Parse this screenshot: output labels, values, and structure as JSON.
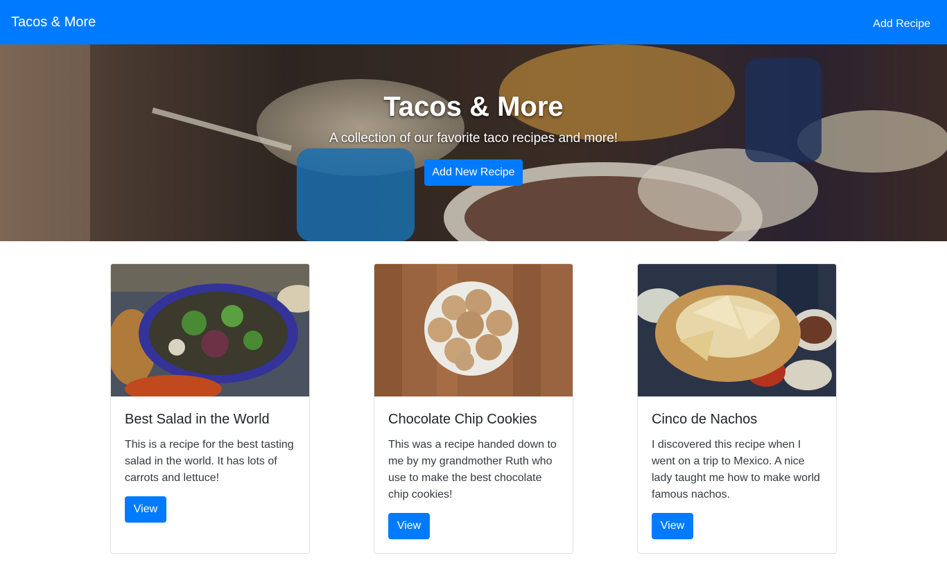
{
  "navbar": {
    "brand": "Tacos & More",
    "add_recipe_link": "Add Recipe"
  },
  "hero": {
    "title": "Tacos & More",
    "subtitle": "A collection of our favorite taco recipes and more!",
    "button_label": "Add New Recipe"
  },
  "cards": [
    {
      "title": "Best Salad in the World",
      "text": "This is a recipe for the best tasting salad in the world. It has lots of carrots and lettuce!",
      "button_label": "View"
    },
    {
      "title": "Chocolate Chip Cookies",
      "text": "This was a recipe handed down to me by my grandmother Ruth who use to make the best chocolate chip cookies!",
      "button_label": "View"
    },
    {
      "title": "Cinco de Nachos",
      "text": "I discovered this recipe when I went on a trip to Mexico. A nice lady taught me how to make world famous nachos.",
      "button_label": "View"
    }
  ],
  "colors": {
    "primary": "#007bff",
    "text": "#212529"
  }
}
